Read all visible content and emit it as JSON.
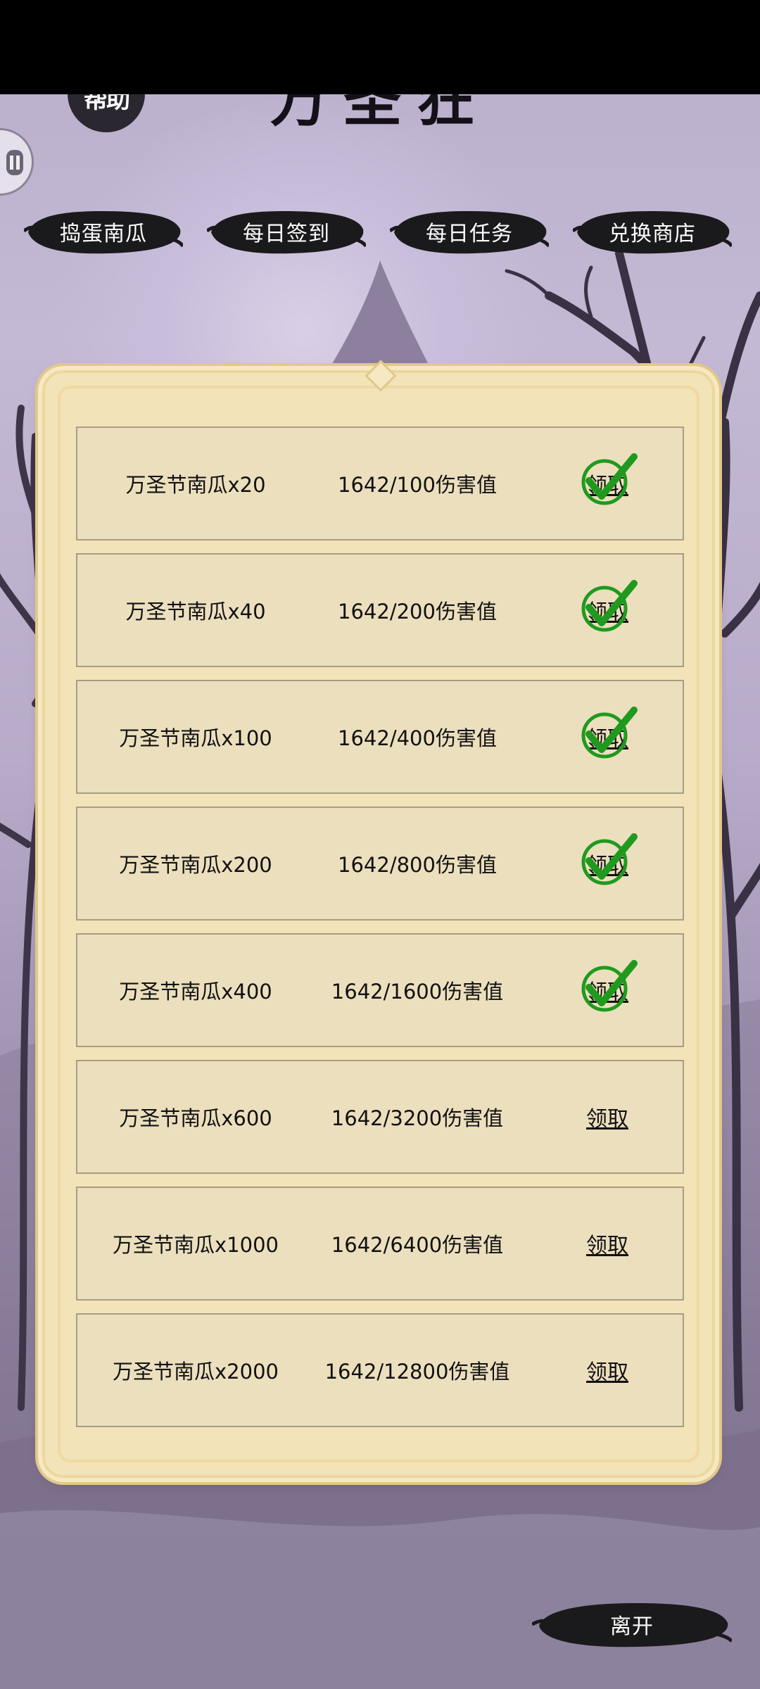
{
  "header": {
    "badge_text": "帮助",
    "title": "万圣狂欢"
  },
  "tabs": [
    {
      "label": "捣蛋南瓜"
    },
    {
      "label": "每日签到"
    },
    {
      "label": "每日任务"
    },
    {
      "label": "兑换商店"
    }
  ],
  "rewards": [
    {
      "name": "万圣节南瓜x20",
      "progress": "1642/100伤害值",
      "claim_label": "领取",
      "claimed": true
    },
    {
      "name": "万圣节南瓜x40",
      "progress": "1642/200伤害值",
      "claim_label": "领取",
      "claimed": true
    },
    {
      "name": "万圣节南瓜x100",
      "progress": "1642/400伤害值",
      "claim_label": "领取",
      "claimed": true
    },
    {
      "name": "万圣节南瓜x200",
      "progress": "1642/800伤害值",
      "claim_label": "领取",
      "claimed": true
    },
    {
      "name": "万圣节南瓜x400",
      "progress": "1642/1600伤害值",
      "claim_label": "领取",
      "claimed": true
    },
    {
      "name": "万圣节南瓜x600",
      "progress": "1642/3200伤害值",
      "claim_label": "领取",
      "claimed": false
    },
    {
      "name": "万圣节南瓜x1000",
      "progress": "1642/6400伤害值",
      "claim_label": "领取",
      "claimed": false
    },
    {
      "name": "万圣节南瓜x2000",
      "progress": "1642/12800伤害值",
      "claim_label": "领取",
      "claimed": false
    }
  ],
  "footer": {
    "leave_label": "离开"
  },
  "colors": {
    "panel": "#f3e3b8",
    "row": "#ecdfbe",
    "check": "#1f9a1f",
    "ink": "#1a1a1c"
  },
  "icons": {
    "claimed": "check-icon",
    "side": "chat-icon"
  }
}
